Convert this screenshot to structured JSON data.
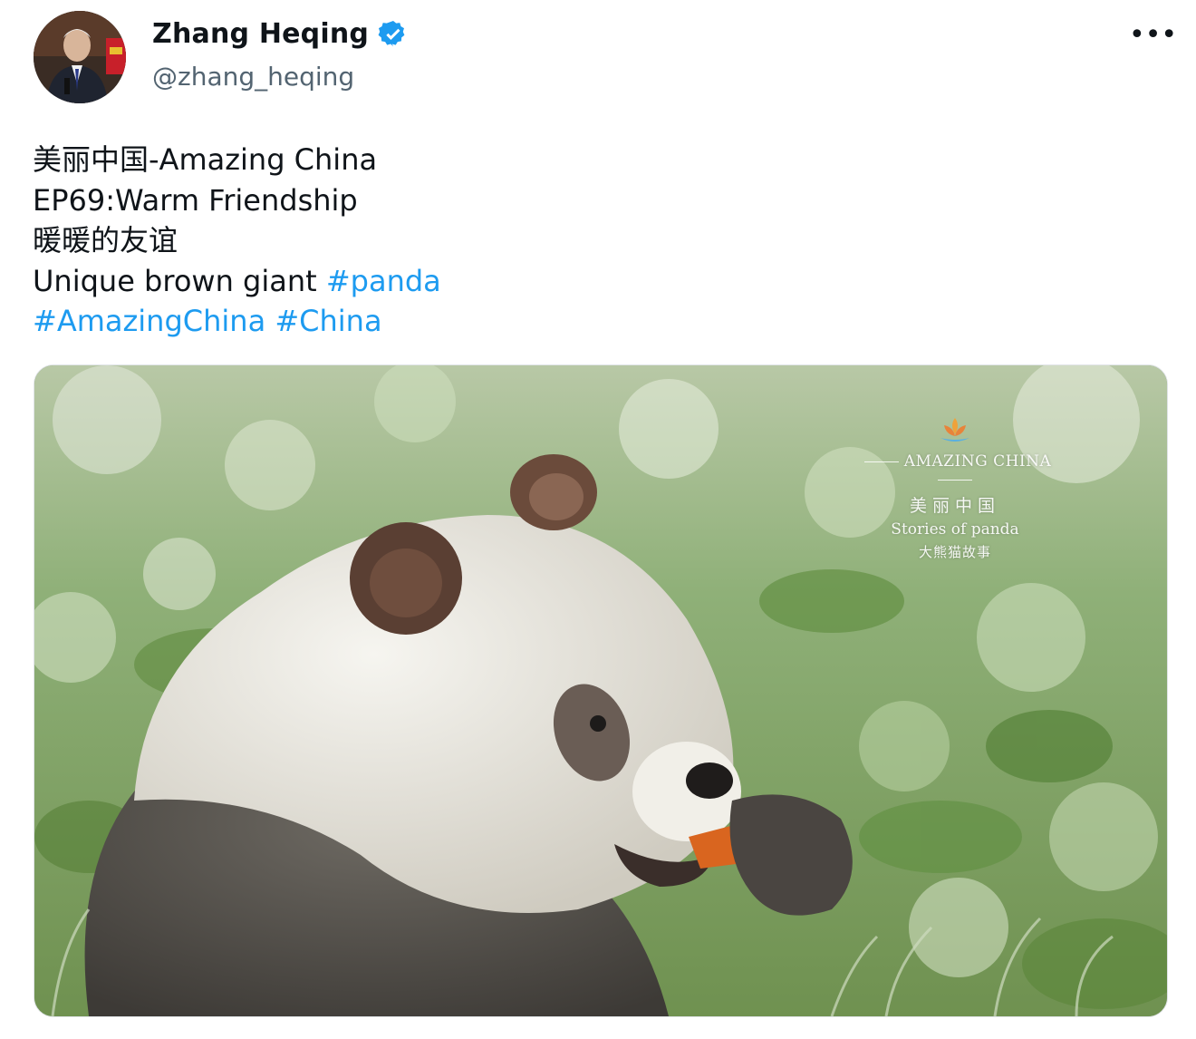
{
  "author": {
    "display_name": "Zhang Heqing",
    "handle": "@zhang_heqing",
    "verified_icon": "verified-badge-icon",
    "avatar_icon": "avatar-photo"
  },
  "more_menu": {
    "label": "•••",
    "icon": "more-icon"
  },
  "tweet": {
    "line1": "美丽中国-Amazing China",
    "line2": "EP69:Warm Friendship",
    "line3": "暖暖的友谊",
    "line4_text": "Unique brown giant ",
    "hashtag_panda": "#panda",
    "hashtag_amazingchina": "#AmazingChina",
    "hashtag_china": "#China"
  },
  "media": {
    "watermark_title": "AMAZING CHINA",
    "watermark_cn": "美丽中国",
    "watermark_subtitle": "Stories of panda",
    "watermark_cn2": "大熊猫故事"
  },
  "colors": {
    "link": "#1d9bf0",
    "text": "#0f1419",
    "secondary": "#536471"
  }
}
